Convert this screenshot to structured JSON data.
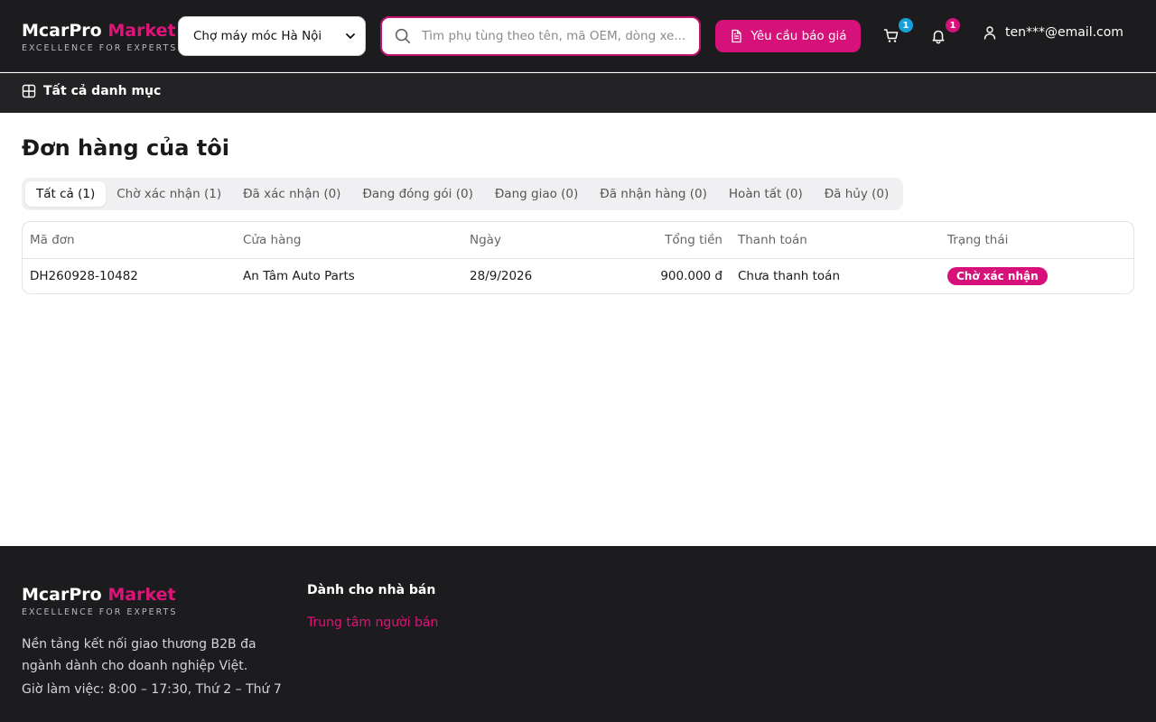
{
  "brand": {
    "name": "McarPro",
    "accent": "Market",
    "tagline": "EXCELLENCE FOR EXPERTS",
    "accent_color": "#e0137a"
  },
  "header": {
    "market_select": {
      "selected": "Chợ máy móc Hà Nội"
    },
    "search": {
      "placeholder": "Tìm phụ tùng theo tên, mã OEM, dòng xe...",
      "value": ""
    },
    "quote_button": {
      "label": "Yêu cầu báo giá",
      "icon": "document-icon"
    },
    "cart": {
      "icon": "cart-icon",
      "count": "1",
      "badge_color": "#1aa0d8"
    },
    "notifications": {
      "icon": "bell-icon",
      "count": "1",
      "badge_color": "#d6127a"
    },
    "user": {
      "icon": "user-icon",
      "email": "ten***@email.com"
    }
  },
  "category_bar": {
    "button": {
      "icon": "grid-icon",
      "label": "Tất cả danh mục"
    }
  },
  "main": {
    "title": "Đơn hàng của tôi",
    "tabs": [
      {
        "label": "Tất cả (1)",
        "active": true
      },
      {
        "label": "Chờ xác nhận (1)",
        "active": false
      },
      {
        "label": "Đã xác nhận (0)",
        "active": false
      },
      {
        "label": "Đang đóng gói (0)",
        "active": false
      },
      {
        "label": "Đang giao (0)",
        "active": false
      },
      {
        "label": "Đã nhận hàng (0)",
        "active": false
      },
      {
        "label": "Hoàn tất (0)",
        "active": false
      },
      {
        "label": "Đã hủy (0)",
        "active": false
      }
    ],
    "table": {
      "columns": [
        "Mã đơn",
        "Cửa hàng",
        "Ngày",
        "Tổng tiền",
        "Thanh toán",
        "Trạng thái"
      ],
      "rows": [
        {
          "order_id": "DH260928-10482",
          "store": "An Tâm Auto Parts",
          "date": "28/9/2026",
          "total": "900.000 đ",
          "payment": "Chưa thanh toán",
          "status": "Chờ xác nhận"
        }
      ]
    }
  },
  "footer": {
    "description": "Nền tảng kết nối giao thương B2B đa ngành dành cho doanh nghiệp Việt.",
    "hours": "Giờ làm việc: 8:00 – 17:30, Thứ 2 – Thứ 7",
    "seller_heading": "Dành cho nhà bán",
    "seller_link": "Trung tâm người bán"
  }
}
